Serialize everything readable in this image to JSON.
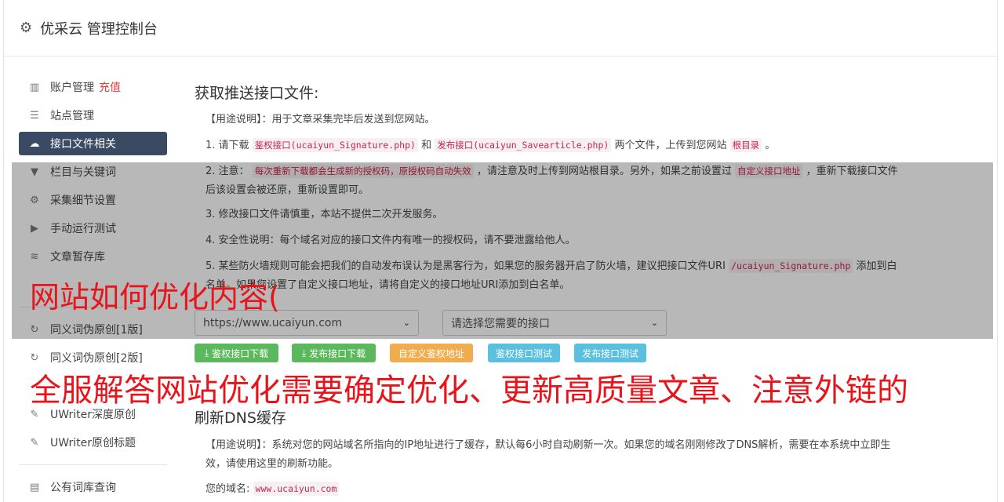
{
  "header": {
    "title": "优采云 管理控制台",
    "icon": "gear-icon"
  },
  "sidebar": {
    "items": [
      {
        "label": "账户管理",
        "badge": "充值",
        "icon": "bar-chart-icon"
      },
      {
        "label": "站点管理",
        "icon": "server-icon"
      },
      {
        "label": "接口文件相关",
        "icon": "cloud-download-icon",
        "active": true
      },
      {
        "label": "栏目与关键词",
        "icon": "filter-icon"
      },
      {
        "label": "采集细节设置",
        "icon": "gears-icon"
      },
      {
        "label": "手动运行测试",
        "icon": "play-circle-icon"
      },
      {
        "label": "文章暂存库",
        "icon": "database-icon"
      },
      {
        "label": "同义词伪原创[1版]",
        "icon": "refresh-icon"
      },
      {
        "label": "同义词伪原创[2版]",
        "icon": "refresh-icon"
      },
      {
        "label": "UWriter深度原创",
        "icon": "edit-icon"
      },
      {
        "label": "UWriter原创标题",
        "icon": "edit-icon"
      },
      {
        "label": "公有词库查询",
        "icon": "book-icon"
      }
    ]
  },
  "interface": {
    "title": "获取推送接口文件:",
    "usage": "【用途说明】：用于文章采集完毕后发送到您网站。",
    "step1": {
      "prefix": "1. 请下载",
      "link1": "鉴权接口(ucaiyun_Signature.php)",
      "and": "和",
      "link2": "发布接口(ucaiyun_Savearticle.php)",
      "mid": "两个文件，上传到您网站",
      "root": "根目录",
      "end": "。"
    },
    "step2": {
      "prefix": "2. 注意：",
      "warn": "每次重新下载都会生成新的授权码，原授权码自动失效",
      "mid": "，请注意及时上传到网站根目录。另外，如果之前设置过",
      "custom": "自定义接口地址",
      "end": "，重新下载接口文件后该设置会被还原，重新设置即可。"
    },
    "step3": "3. 修改接口文件请慎重，本站不提供二次开发服务。",
    "step4": "4. 安全性说明：每个域名对应的接口文件内有唯一的授权码，请不要泄露给他人。",
    "step5": {
      "prefix": "5. 某些防火墙规则可能会把我们的自动发布误认为是黑客行为，如果您的服务器开启了防火墙，建议把接口文件URI",
      "uri": "/ucaiyun_Signature.php",
      "end": "添加到白名单。如果您设置了自定义接口地址，请将自定义的接口地址URI添加到白名单。"
    },
    "site_select": "https://www.ucaiyun.com",
    "api_select": "请选择您需要的接口",
    "buttons": {
      "download_auth": "鉴权接口下载",
      "download_publish": "发布接口下载",
      "custom_auth": "自定义鉴权地址",
      "test_auth": "鉴权接口测试",
      "test_publish": "发布接口测试"
    }
  },
  "dns": {
    "title": "刷新DNS缓存",
    "usage": "【用途说明】：系统对您的网站域名所指向的IP地址进行了缓存，默认每6小时自动刷新一次。如果您的域名刚刚修改了DNS解析，需要在本系统中立即生效，请使用这里的刷新功能。",
    "domain_label": "您的域名:",
    "domain_value": "www.ucaiyun.com"
  },
  "overlay": {
    "line1": "网站如何优化内容(",
    "line2": "全服解答网站优化需要确定优化、更新高质量文章、注意外链的"
  },
  "colors": {
    "active_nav": "#3a4a63",
    "highlight": "#e4393c",
    "overlay_text": "#e8141b"
  }
}
